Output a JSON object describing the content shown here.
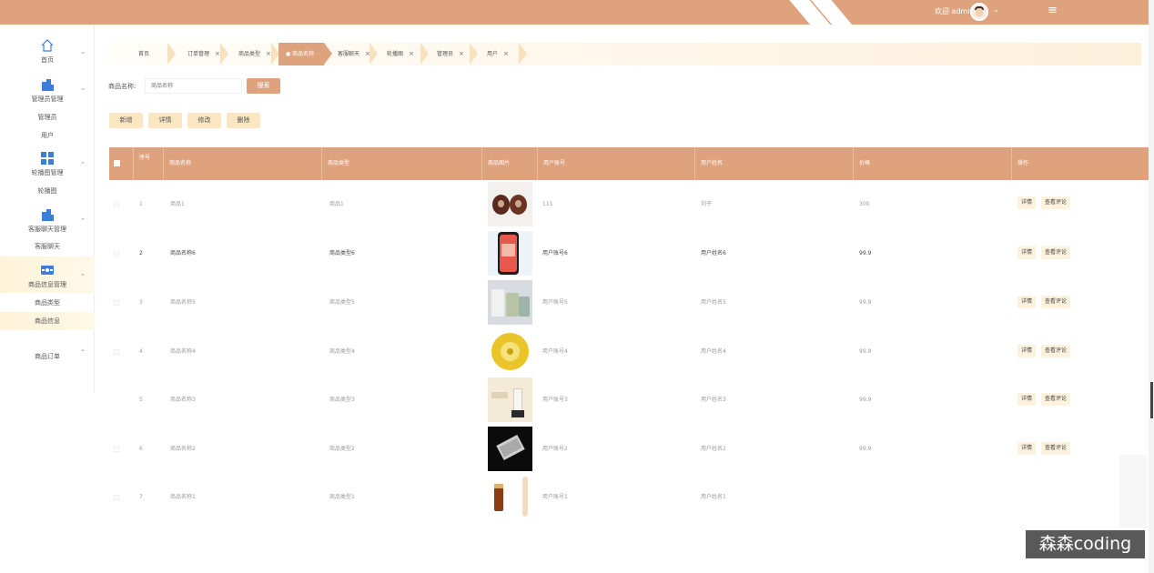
{
  "header": {
    "welcome": "欢迎 admin",
    "menu_icon": "hamburger-icon",
    "colors": {
      "primary": "#dea27d",
      "accent": "#fbe6c3"
    }
  },
  "sidebar": {
    "groups": [
      {
        "label": "首页",
        "icon": "home-icon"
      },
      {
        "label": "管理员管理",
        "icon": "building-icon",
        "children": [
          "管理员",
          "用户"
        ]
      },
      {
        "label": "轮播图管理",
        "icon": "grid-icon",
        "children": [
          "轮播图"
        ]
      },
      {
        "label": "客服聊天管理",
        "icon": "building-icon",
        "children": [
          "客服聊天"
        ]
      },
      {
        "label": "商品信息管理",
        "icon": "card-icon",
        "children": [
          "商品类型",
          "商品信息"
        ]
      },
      {
        "label": "商品订单",
        "icon": ""
      }
    ]
  },
  "tabs": [
    {
      "label": "首页",
      "closable": false
    },
    {
      "label": "订单管理",
      "closable": true
    },
    {
      "label": "商品类型",
      "closable": true
    },
    {
      "label": "● 商品名称",
      "closable": true,
      "active": true
    },
    {
      "label": "客服聊天",
      "closable": true
    },
    {
      "label": "轮播图",
      "closable": true
    },
    {
      "label": "管理员",
      "closable": true
    },
    {
      "label": "用户",
      "closable": true
    }
  ],
  "search": {
    "label": "商品名称:",
    "placeholder": "商品名称",
    "button": "搜索"
  },
  "actions": [
    "新增",
    "详情",
    "修改",
    "删除"
  ],
  "table": {
    "columns": [
      "序号",
      "商品名称",
      "商品类型",
      "商品图片",
      "用户账号",
      "用户姓名",
      "价格",
      "操作"
    ],
    "rows": [
      {
        "index": "1",
        "name": "商品1",
        "type": "商品1",
        "account": "111",
        "user": "刘子",
        "price": "300"
      },
      {
        "index": "2",
        "name": "商品名称6",
        "type": "商品类型6",
        "account": "用户账号6",
        "user": "用户姓名6",
        "price": "99.9"
      },
      {
        "index": "3",
        "name": "商品名称5",
        "type": "商品类型5",
        "account": "用户账号5",
        "user": "用户姓名5",
        "price": "99.9"
      },
      {
        "index": "4",
        "name": "商品名称4",
        "type": "商品类型4",
        "account": "用户账号4",
        "user": "用户姓名4",
        "price": "99.9"
      },
      {
        "index": "5",
        "name": "商品名称3",
        "type": "商品类型3",
        "account": "用户账号3",
        "user": "用户姓名3",
        "price": "99.9"
      },
      {
        "index": "6",
        "name": "商品名称2",
        "type": "商品类型2",
        "account": "用户账号2",
        "user": "用户姓名2",
        "price": "99.9"
      },
      {
        "index": "7",
        "name": "商品名称1",
        "type": "商品类型1",
        "account": "用户账号1",
        "user": "用户姓名1",
        "price": ""
      }
    ],
    "row_buttons": [
      "详情",
      "查看评论"
    ]
  },
  "watermark": "森森coding"
}
